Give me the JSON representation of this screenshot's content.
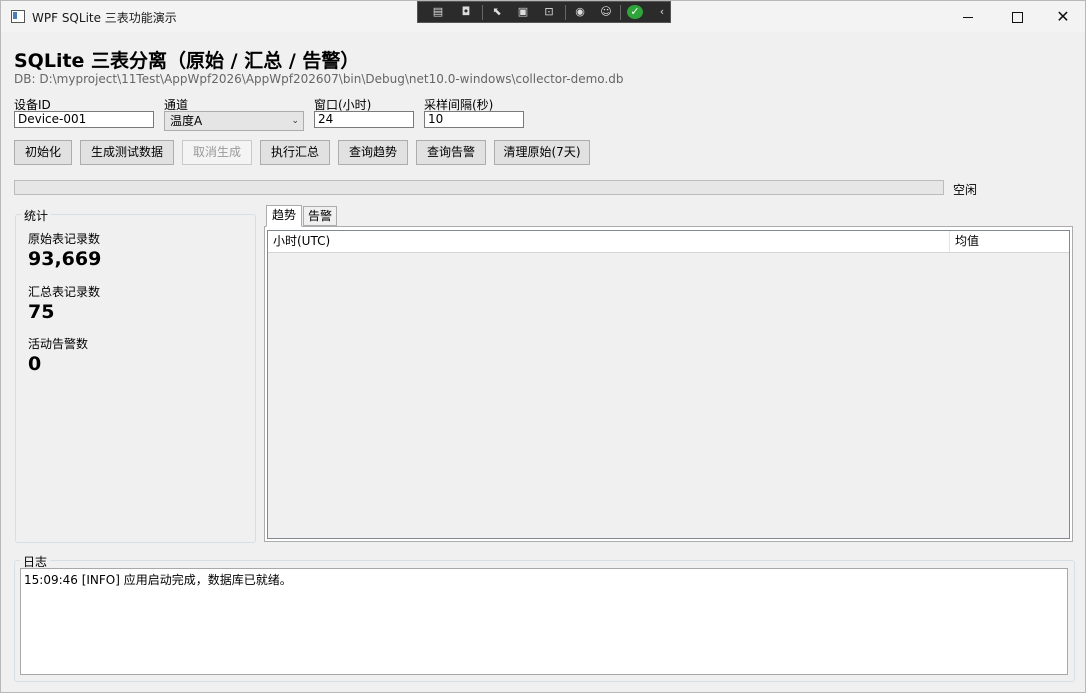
{
  "window": {
    "title": "WPF SQLite 三表功能演示",
    "minimize_icon": "minimize-icon",
    "maximize_icon": "maximize-icon",
    "close_icon": "close-icon"
  },
  "devtools": [
    "live-visual-tree-icon",
    "camera-icon",
    "select-element-icon",
    "display-layout-adorners-icon",
    "track-focus-icon",
    "hot-reload-icon",
    "accessibility-icon",
    "ok-check-icon",
    "collapse-chevron-icon"
  ],
  "header": {
    "title": "SQLite 三表分离（原始 / 汇总 / 告警）",
    "db_path": "DB: D:\\myproject\\11Test\\AppWpf2026\\AppWpf202607\\bin\\Debug\\net10.0-windows\\collector-demo.db"
  },
  "form": {
    "device_label": "设备ID",
    "device_value": "Device-001",
    "channel_label": "通道",
    "channel_value": "温度A",
    "window_label": "窗口(小时)",
    "window_value": "24",
    "interval_label": "采样间隔(秒)",
    "interval_value": "10"
  },
  "toolbar": {
    "init": "初始化",
    "generate": "生成测试数据",
    "cancel": "取消生成",
    "aggregate": "执行汇总",
    "query_trend": "查询趋势",
    "query_alarm": "查询告警",
    "purge": "清理原始(7天)"
  },
  "progress": {
    "value": 0,
    "status": "空闲"
  },
  "stats": {
    "title": "统计",
    "raw_label": "原始表记录数",
    "raw_value": "93,669",
    "summary_label": "汇总表记录数",
    "summary_value": "75",
    "alarm_label": "活动告警数",
    "alarm_value": "0"
  },
  "tabs": [
    {
      "label": "趋势",
      "active": true
    },
    {
      "label": "告警",
      "active": false
    }
  ],
  "trend_grid": {
    "columns": [
      "小时(UTC)",
      "均值"
    ],
    "rows": []
  },
  "log": {
    "title": "日志",
    "lines": [
      "15:09:46 [INFO] 应用启动完成，数据库已就绪。"
    ]
  }
}
